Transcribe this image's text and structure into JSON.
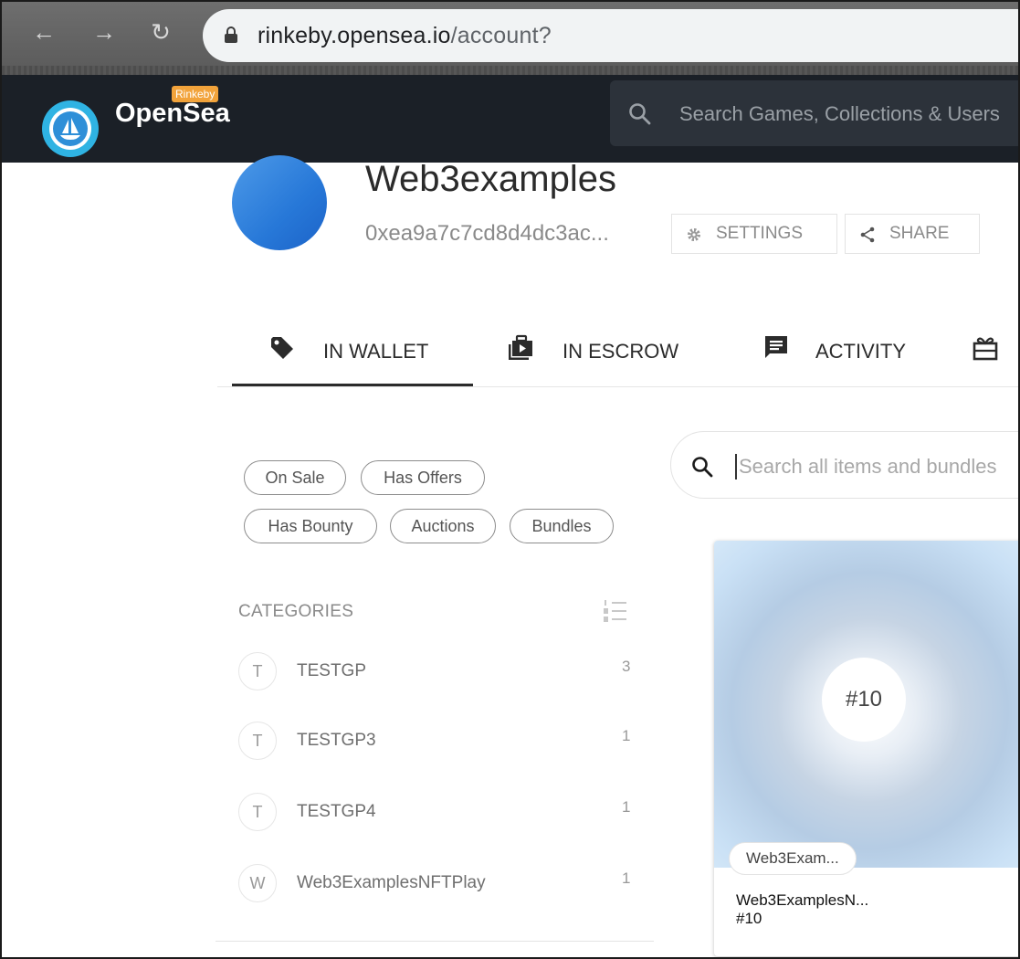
{
  "browser": {
    "url_host": "rinkeby.opensea.io",
    "url_path": "/account?"
  },
  "header": {
    "brand": "OpenSea",
    "network_badge": "Rinkeby",
    "search_placeholder": "Search Games, Collections & Users"
  },
  "profile": {
    "username": "Web3examples",
    "address": "0xea9a7c7cd8d4dc3ac...",
    "settings_label": "SETTINGS",
    "share_label": "SHARE"
  },
  "tabs": [
    {
      "label": "IN WALLET",
      "icon": "tag-icon",
      "active": true
    },
    {
      "label": "IN ESCROW",
      "icon": "briefcase-icon",
      "active": false
    },
    {
      "label": "ACTIVITY",
      "icon": "message-list-icon",
      "active": false
    },
    {
      "label": "",
      "icon": "gift-icon",
      "active": false
    }
  ],
  "filters": {
    "chips": [
      "On Sale",
      "Has Offers",
      "Has Bounty",
      "Auctions",
      "Bundles"
    ],
    "items_search_placeholder": "Search all items and bundles"
  },
  "categories": {
    "heading": "CATEGORIES",
    "items": [
      {
        "initial": "T",
        "name": "TESTGP",
        "count": "3"
      },
      {
        "initial": "T",
        "name": "TESTGP3",
        "count": "1"
      },
      {
        "initial": "T",
        "name": "TESTGP4",
        "count": "1"
      },
      {
        "initial": "W",
        "name": "Web3ExamplesNFTPlay",
        "count": "1"
      }
    ]
  },
  "card": {
    "badge": "#10",
    "collection": "Web3Exam...",
    "title": "Web3ExamplesN...",
    "subtitle": "#10"
  },
  "colors": {
    "topbar": "#1b2027",
    "network_badge": "#f2a33b",
    "avatar": "#2778d8"
  }
}
